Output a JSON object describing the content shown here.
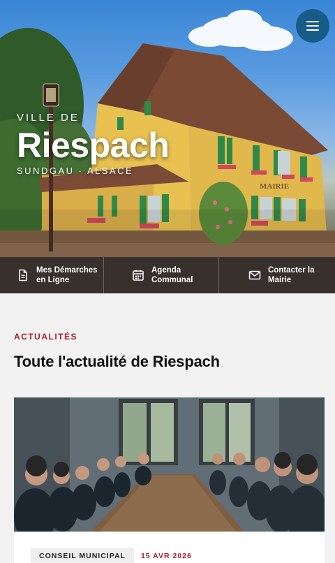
{
  "hero": {
    "kicker": "VILLE DE",
    "title": "Riespach",
    "subtitle": "SUNDGAU · ALSACE",
    "sign": "MAIRIE"
  },
  "menu": {
    "icon": "hamburger-menu-icon"
  },
  "quick_links": [
    {
      "label": "Mes Démarches en Ligne",
      "icon": "document-icon"
    },
    {
      "label": "Agenda Communal",
      "icon": "calendar-icon"
    },
    {
      "label": "Contacter la Mairie",
      "icon": "mail-icon"
    }
  ],
  "news": {
    "kicker": "ACTUALITÉS",
    "title": "Toute l'actualité de Riespach",
    "cards": [
      {
        "category": "CONSEIL MUNICIPAL",
        "date": "15 AVR 2026"
      }
    ]
  },
  "colors": {
    "accent": "#b01c2e",
    "menu_button": "#175b87",
    "quick_bar": "#2a221e"
  }
}
